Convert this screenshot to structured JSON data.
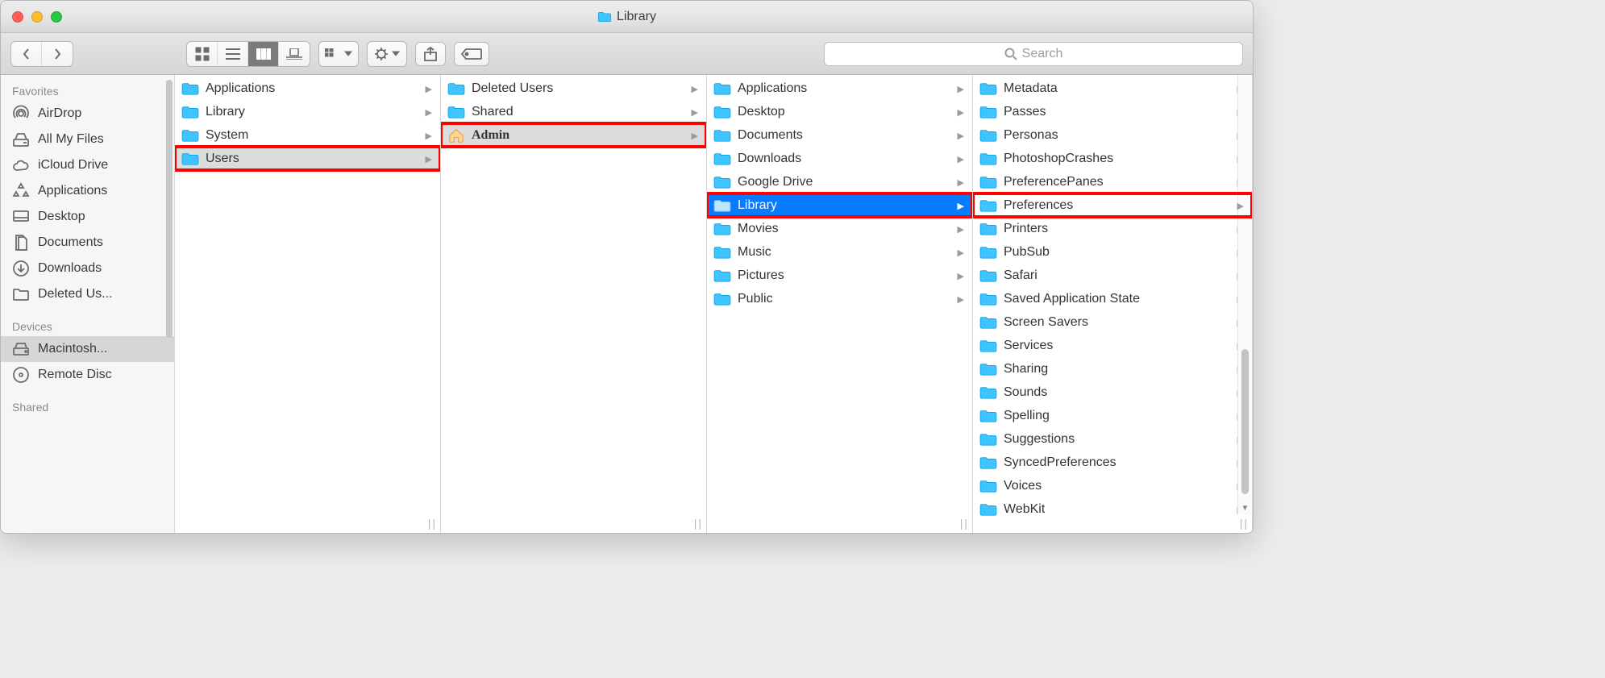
{
  "window": {
    "title": "Library"
  },
  "toolbar": {
    "search_placeholder": "Search"
  },
  "sidebar": {
    "heading_favorites": "Favorites",
    "heading_devices": "Devices",
    "heading_shared": "Shared",
    "favorites": [
      {
        "id": "airdrop",
        "label": "AirDrop",
        "icon": "airdrop"
      },
      {
        "id": "allmyfiles",
        "label": "All My Files",
        "icon": "allmyfiles"
      },
      {
        "id": "iclouddrive",
        "label": "iCloud Drive",
        "icon": "cloud"
      },
      {
        "id": "applications",
        "label": "Applications",
        "icon": "apps"
      },
      {
        "id": "desktop",
        "label": "Desktop",
        "icon": "desktop"
      },
      {
        "id": "documents",
        "label": "Documents",
        "icon": "documents"
      },
      {
        "id": "downloads",
        "label": "Downloads",
        "icon": "downloads"
      },
      {
        "id": "deletedusers",
        "label": "Deleted Us...",
        "icon": "folder"
      }
    ],
    "devices": [
      {
        "id": "macintosh",
        "label": "Macintosh...",
        "icon": "hdd",
        "selected": true
      },
      {
        "id": "remotedisc",
        "label": "Remote Disc",
        "icon": "disc"
      }
    ]
  },
  "columns": [
    {
      "id": "root",
      "items": [
        {
          "label": "Applications",
          "icon": "apps-folder"
        },
        {
          "label": "Library",
          "icon": "folder"
        },
        {
          "label": "System",
          "icon": "system-folder"
        },
        {
          "label": "Users",
          "icon": "users-folder",
          "path_selected": true,
          "highlight": true
        }
      ]
    },
    {
      "id": "users",
      "items": [
        {
          "label": "Deleted Users",
          "icon": "folder"
        },
        {
          "label": "Shared",
          "icon": "folder"
        },
        {
          "label": "Admin",
          "icon": "home",
          "path_selected": true,
          "highlight": true,
          "bold": true
        }
      ]
    },
    {
      "id": "admin",
      "items": [
        {
          "label": "Applications",
          "icon": "apps-folder"
        },
        {
          "label": "Desktop",
          "icon": "folder"
        },
        {
          "label": "Documents",
          "icon": "folder"
        },
        {
          "label": "Downloads",
          "icon": "downloads-folder"
        },
        {
          "label": "Google Drive",
          "icon": "folder"
        },
        {
          "label": "Library",
          "icon": "folder",
          "selected": true,
          "highlight": true
        },
        {
          "label": "Movies",
          "icon": "movies-folder"
        },
        {
          "label": "Music",
          "icon": "music-folder"
        },
        {
          "label": "Pictures",
          "icon": "pictures-folder"
        },
        {
          "label": "Public",
          "icon": "folder"
        }
      ]
    },
    {
      "id": "library",
      "scrollbar": true,
      "items": [
        {
          "label": "Metadata"
        },
        {
          "label": "Passes"
        },
        {
          "label": "Personas"
        },
        {
          "label": "PhotoshopCrashes"
        },
        {
          "label": "PreferencePanes"
        },
        {
          "label": "Preferences",
          "highlight": true
        },
        {
          "label": "Printers"
        },
        {
          "label": "PubSub"
        },
        {
          "label": "Safari"
        },
        {
          "label": "Saved Application State"
        },
        {
          "label": "Screen Savers"
        },
        {
          "label": "Services"
        },
        {
          "label": "Sharing"
        },
        {
          "label": "Sounds"
        },
        {
          "label": "Spelling"
        },
        {
          "label": "Suggestions"
        },
        {
          "label": "SyncedPreferences"
        },
        {
          "label": "Voices"
        },
        {
          "label": "WebKit"
        }
      ]
    }
  ]
}
